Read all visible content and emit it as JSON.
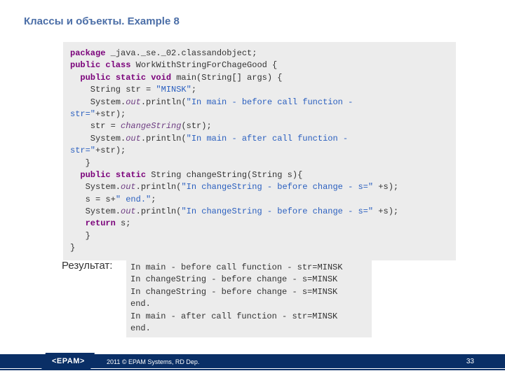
{
  "title": "Классы и объекты. Example 8",
  "code": {
    "kw_package": "package",
    "pkg_name": " _java._se._02.classandobject;",
    "kw_public_class": "public class",
    "class_name": " WorkWithStringForChageGood {",
    "kw_psv": "public static void",
    "main_sig": " main(String[] args) {",
    "decl_str": "    String str = ",
    "lit_minsk": "\"MINSK\"",
    "semicolon": ";",
    "sysout1a": "    System.",
    "out": "out",
    "sysout1b": ".println(",
    "lit_before_main": "\"In main - before call function - \nstr=\"",
    "plus_str_close": "+str);",
    "call_change": "    str = ",
    "changeString_call": "changeString",
    "call_change_tail": "(str);",
    "lit_after_main": "\"In main - after call function - \nstr=\"",
    "brace_close": "   }",
    "kw_ps_string": "public static",
    "change_sig": " String changeString(String s){",
    "sysout_cs_a": "   System.",
    "sysout_cs_b": ".println(",
    "lit_cs_before": "\"In changeString - before change - s=\"",
    "plus_s_close": " +s);",
    "assign_s": "   s = s+",
    "lit_end": "\" end.\"",
    "kw_return": "return",
    "return_tail": " s;",
    "brace_close2": "   }",
    "brace_close3": "}"
  },
  "result_label": "Результат:",
  "output": "In main - before call function - str=MINSK\nIn changeString - before change - s=MINSK\nIn changeString - before change - s=MINSK \nend.\nIn main - after call function - str=MINSK \nend.",
  "footer": {
    "logo": "<EPAM>",
    "copyright": "2011 © EPAM Systems, RD Dep.",
    "page": "33"
  }
}
